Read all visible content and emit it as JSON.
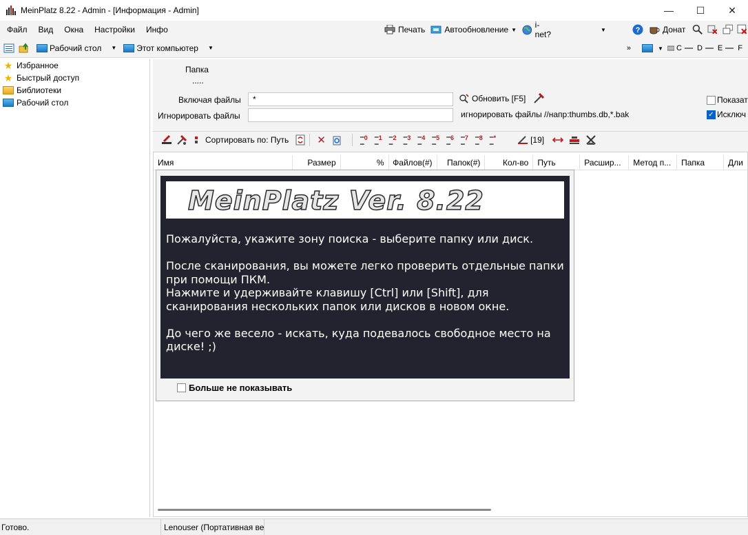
{
  "window": {
    "title": "MeinPlatz 8.22 - Admin - [Информация - Admin]",
    "minimize_glyph": "—",
    "maximize_glyph": "☐",
    "close_glyph": "✕"
  },
  "menu": {
    "items": [
      "Файл",
      "Вид",
      "Окна",
      "Настройки",
      "Инфо"
    ],
    "print": "Печать",
    "autoupdate": "Автообновление",
    "inet": "i-net?",
    "donate": "Донат"
  },
  "address": {
    "desktop": "Рабочий стол",
    "computer": "Этот компьютер",
    "drives": [
      "C",
      "D",
      "E",
      "F"
    ]
  },
  "tree": {
    "items": [
      {
        "label": "Избранное",
        "icon": "star-icon"
      },
      {
        "label": "Быстрый доступ",
        "icon": "star-icon"
      },
      {
        "label": "Библиотеки",
        "icon": "folder-icon"
      },
      {
        "label": "Рабочий стол",
        "icon": "desktop-icon"
      }
    ]
  },
  "filters": {
    "folder_label": "Папка",
    "folder_value": ".....",
    "include_label": "Включая файлы",
    "include_value": "*",
    "ignore_label": "Игнорировать файлы",
    "ignore_value": "",
    "refresh": "Обновить [F5]",
    "ignore_hint": "игнорировать файлы //напр:thumbs.db,*.bak",
    "show_label": "Показат",
    "exclude_label": "Исключ"
  },
  "toolbar": {
    "sort_label": "Сортировать по: Путь",
    "levels": [
      "0",
      "1",
      "2",
      "3",
      "4",
      "5",
      "6",
      "7",
      "8",
      "*"
    ],
    "count": "[19]"
  },
  "columns": [
    "Имя",
    "Размер",
    "%",
    "Файлов(#)",
    "Папок(#)",
    "Кол-во",
    "Путь",
    "Расшир...",
    "Метод п...",
    "Папка",
    "Дли"
  ],
  "dialog": {
    "banner": "MeinPlatz Ver. 8.22",
    "message": "Пожалуйста, укажите зону поиска - выберите папку или диск.\n\nПосле сканирования, вы можете легко проверить отдельные папки при помощи ПКМ.\nНажмите и удерживайте клавишу [Ctrl] или [Shift], для сканирования нескольких папок или дисков в новом окне.\n\nДо чего же весело - искать, куда подевалось свободное место на диске! ;)",
    "dont_show": "Больше не показывать"
  },
  "status": {
    "ready": "Готово.",
    "user": "Lenouser (Портативная вер"
  }
}
